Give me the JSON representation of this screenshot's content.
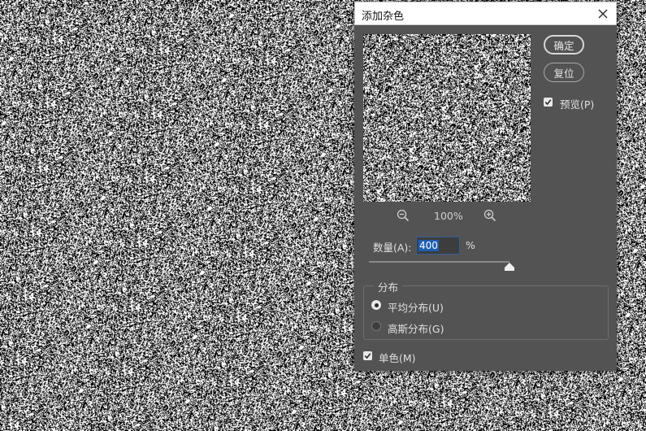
{
  "dialog": {
    "title": "添加杂色",
    "ok_label": "确定",
    "reset_label": "复位",
    "preview_label": "预览(P)",
    "preview_checked": true,
    "zoom_level": "100%",
    "amount_label": "数量(A):",
    "amount_value": "400",
    "amount_unit": "%",
    "amount_slider_fraction": 1.0,
    "distribution": {
      "legend": "分布",
      "options": [
        {
          "label": "平均分布(U)",
          "selected": true
        },
        {
          "label": "高斯分布(G)",
          "selected": false
        }
      ]
    },
    "monochromatic_label": "单色(M)",
    "monochromatic_checked": true
  },
  "icons": [
    "close-icon",
    "zoom-out-icon",
    "zoom-in-icon",
    "checkmark-icon",
    "slider-thumb-icon"
  ],
  "colors": {
    "dialog_bg": "#535353",
    "titlebar_bg": "#ffffff",
    "input_focus_border": "#2f5f9c",
    "selection": "#1e5fb3"
  }
}
